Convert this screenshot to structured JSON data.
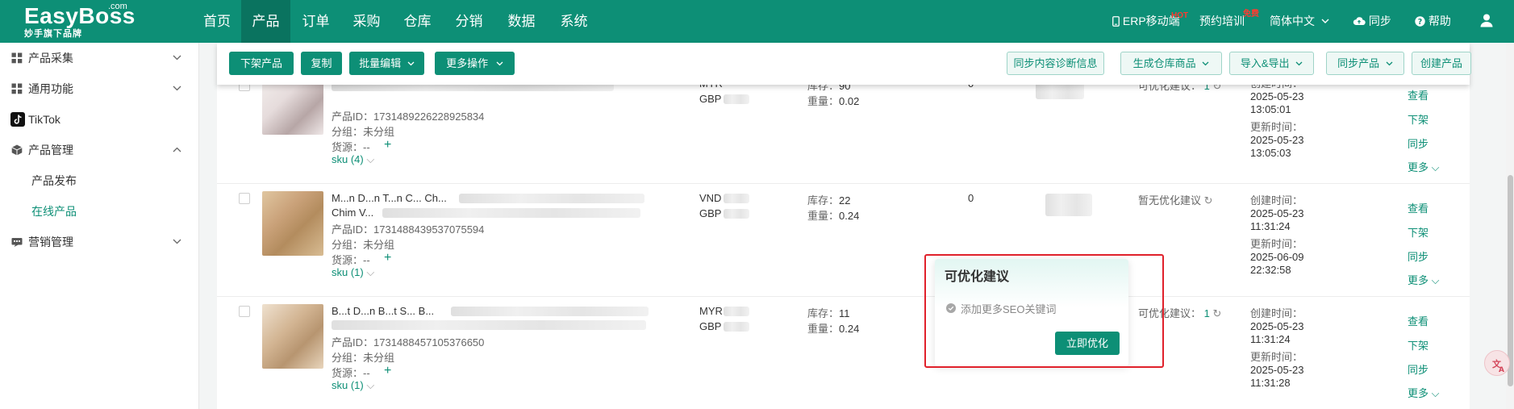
{
  "brand": {
    "name": "EasyBoss",
    "com": ".com",
    "tagline": "妙手旗下品牌"
  },
  "nav": [
    "首页",
    "产品",
    "订单",
    "采购",
    "仓库",
    "分销",
    "数据",
    "系统"
  ],
  "nav_right": {
    "erp": "ERP移动端",
    "hot": "HOT",
    "training": "预约培训",
    "free": "免费",
    "lang": "简体中文",
    "sync": "同步",
    "help": "帮助"
  },
  "sidebar": {
    "items": [
      "产品采集",
      "通用功能",
      "TikTok",
      "产品管理"
    ],
    "sub": [
      "产品发布",
      "在线产品"
    ],
    "marketing": "营销管理"
  },
  "toolbar": {
    "delist": "下架产品",
    "copy": "复制",
    "batch": "批量编辑",
    "more_ops": "更多操作",
    "sync_diag": "同步内容诊断信息",
    "gen_wh": "生成仓库商品",
    "import_export": "导入&导出",
    "sync_product": "同步产品",
    "create": "创建产品"
  },
  "labels": {
    "product_id": "产品ID：",
    "group": "分组：",
    "group_value": "未分组",
    "source": "货源：",
    "source_value": "--",
    "stock": "库存：",
    "weight": "重量：",
    "created": "创建时间：",
    "updated": "更新时间：",
    "view": "查看",
    "delist": "下架",
    "sync": "同步",
    "more": "更多"
  },
  "rows": [
    {
      "title_line1": "...",
      "title_line2": "",
      "product_id": "1731489226228925834",
      "sku": "sku (4)",
      "currency1": "MYR",
      "currency2": "GBP",
      "stock": "90",
      "weight": "0.02",
      "count": "0",
      "opt_text": "可优化建议：",
      "opt_num": "1",
      "created_date": "2025-05-23",
      "created_time": "13:05:01",
      "updated_date": "2025-05-23",
      "updated_time": "13:05:03"
    },
    {
      "title_line1": "M...n D...n T...n C... Ch...",
      "title_line2": "Chim V...",
      "product_id": "1731488439537075594",
      "sku": "sku (1)",
      "currency1": "VND",
      "currency2": "GBP",
      "stock": "22",
      "weight": "0.24",
      "count": "0",
      "opt_text": "暂无优化建议",
      "opt_num": "",
      "created_date": "2025-05-23",
      "created_time": "11:31:24",
      "updated_date": "2025-06-09",
      "updated_time": "22:32:58"
    },
    {
      "title_line1": "B...t D...n B...t S... B...",
      "title_line2": "",
      "product_id": "1731488457105376650",
      "sku": "sku (1)",
      "currency1": "MYR",
      "currency2": "GBP",
      "stock": "11",
      "weight": "0.24",
      "count": "",
      "opt_text": "可优化建议：",
      "opt_num": "1",
      "created_date": "2025-05-23",
      "created_time": "11:31:24",
      "updated_date": "2025-05-23",
      "updated_time": "11:31:28"
    }
  ],
  "popover": {
    "title": "可优化建议",
    "tip": "添加更多SEO关键词",
    "button": "立即优化"
  },
  "float_icon": "translate-icon",
  "colors": {
    "brand": "#0d8f76",
    "brand_dark": "#0a735f",
    "highlight": "#e0212b"
  }
}
